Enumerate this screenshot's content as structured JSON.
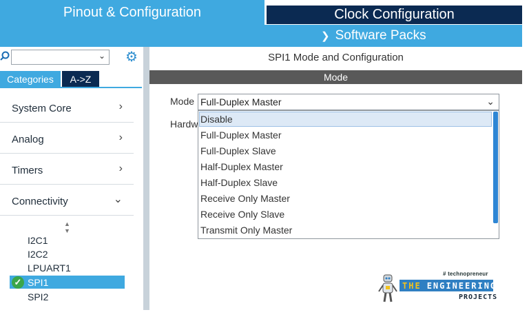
{
  "tabs": {
    "pinout": "Pinout & Configuration",
    "clock": "Clock Configuration",
    "software_packs": "Software Packs"
  },
  "sidebar": {
    "search": {
      "value": ""
    },
    "tabs": {
      "categories": "Categories",
      "az": "A->Z"
    },
    "categories": [
      {
        "label": "System Core",
        "state": "collapsed"
      },
      {
        "label": "Analog",
        "state": "collapsed"
      },
      {
        "label": "Timers",
        "state": "collapsed"
      },
      {
        "label": "Connectivity",
        "state": "expanded"
      }
    ],
    "peripherals": [
      {
        "label": "I2C1"
      },
      {
        "label": "I2C2"
      },
      {
        "label": "LPUART1"
      },
      {
        "label": "SPI1",
        "selected": true,
        "enabled": true
      },
      {
        "label": "SPI2"
      }
    ]
  },
  "config": {
    "title": "SPI1 Mode and Configuration",
    "section": "Mode",
    "mode_label": "Mode",
    "mode_value": "Full-Duplex Master",
    "hw_label": "Hardw",
    "dropdown": {
      "highlighted": "Disable",
      "options": [
        "Disable",
        "Full-Duplex Master",
        "Full-Duplex Slave",
        "Half-Duplex Master",
        "Half-Duplex Slave",
        "Receive Only Master",
        "Receive Only Slave",
        "Transmit Only Master"
      ]
    }
  },
  "watermark": {
    "tagline": "# technopreneur",
    "the": "THE",
    "engineering": "ENGINEERING",
    "projects": "PROJECTS"
  },
  "colors": {
    "accent_blue": "#3fa9e0",
    "navy": "#0b2a52",
    "mode_header": "#595959",
    "check_green": "#3aa64a"
  }
}
